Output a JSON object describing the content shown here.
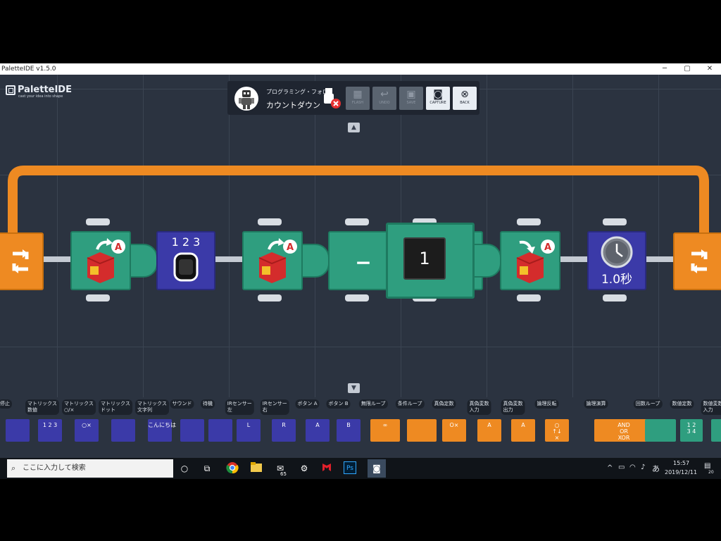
{
  "window": {
    "title": "PaletteIDE v1.5.0",
    "controls": [
      "─",
      "▢",
      "✕"
    ]
  },
  "logo": {
    "name": "PaletteIDE",
    "tagline": "cast your idea into shape"
  },
  "toolbar": {
    "project_label": "プログラミング・フォロ",
    "project_name": "カウントダウン",
    "buttons": [
      {
        "label": "FLASH",
        "enabled": false
      },
      {
        "label": "UNDO",
        "enabled": false
      },
      {
        "label": "SAVE",
        "enabled": false
      },
      {
        "label": "CAPTURE",
        "enabled": true
      },
      {
        "label": "BACK",
        "enabled": true
      }
    ]
  },
  "program": {
    "blocks": [
      {
        "kind": "loop-start"
      },
      {
        "kind": "variable-set",
        "var": "A",
        "icon_label": "123"
      },
      {
        "kind": "matrix-number",
        "digits": "1 2 3"
      },
      {
        "kind": "variable-set",
        "var": "A",
        "icon_label": "123"
      },
      {
        "kind": "operator",
        "symbol": "−"
      },
      {
        "kind": "number",
        "value": "1"
      },
      {
        "kind": "variable-get",
        "var": "A",
        "icon_label": "123"
      },
      {
        "kind": "wait",
        "text": "1.0秒"
      },
      {
        "kind": "loop-end"
      }
    ]
  },
  "palette": {
    "items": [
      {
        "label": "停止",
        "color": "#3b3aa8"
      },
      {
        "label": "マトリックス\n数値",
        "color": "#3b3aa8",
        "glyph": "1 2 3"
      },
      {
        "label": "マトリックス\n○/×",
        "color": "#3b3aa8",
        "glyph": "○×"
      },
      {
        "label": "マトリックス\nドット",
        "color": "#3b3aa8"
      },
      {
        "label": "マトリックス\n文字列",
        "color": "#3b3aa8",
        "glyph": "こんにちは"
      },
      {
        "label": "サウンド",
        "color": "#3b3aa8"
      },
      {
        "label": "待機",
        "color": "#3b3aa8"
      },
      {
        "label": "IRセンサー\n左",
        "color": "#3b3aa8",
        "glyph": "L"
      },
      {
        "label": "IRセンサー\n右",
        "color": "#3b3aa8",
        "glyph": "R"
      },
      {
        "label": "ボタン A",
        "color": "#3b3aa8",
        "glyph": "A"
      },
      {
        "label": "ボタン B",
        "color": "#3b3aa8",
        "glyph": "B"
      },
      {
        "label": "無限ループ",
        "color": "#ee8a22",
        "glyph": "∞"
      },
      {
        "label": "条件ループ",
        "color": "#ee8a22"
      },
      {
        "label": "真偽定数",
        "color": "#ee8a22",
        "glyph": "O×"
      },
      {
        "label": "真偽変数\n入力",
        "color": "#ee8a22",
        "glyph": "A"
      },
      {
        "label": "真偽変数\n出力",
        "color": "#ee8a22",
        "glyph": "A"
      },
      {
        "label": "論理反転",
        "color": "#ee8a22",
        "glyph": "○\n↑↓\n×"
      },
      {
        "label": "論理演算",
        "color": "#ee8a22",
        "glyph": "AND\nOR\nXOR"
      },
      {
        "label": "回数ループ",
        "color": "#2f9e7f"
      },
      {
        "label": "数値定数",
        "color": "#2f9e7f",
        "glyph": "1 2\n3 4"
      },
      {
        "label": "数値変数\n入力",
        "color": "#2f9e7f"
      }
    ]
  },
  "taskbar": {
    "search_placeholder": "ここに入力して検索",
    "mail_badge": "65",
    "ime": "あ",
    "time": "15:57",
    "date": "2019/12/11",
    "notifications": "20"
  },
  "colors": {
    "background": "#2b3340",
    "loop_orange": "#ee8a22",
    "green_block": "#2f9e7f",
    "blue_block": "#3b3aa8"
  }
}
